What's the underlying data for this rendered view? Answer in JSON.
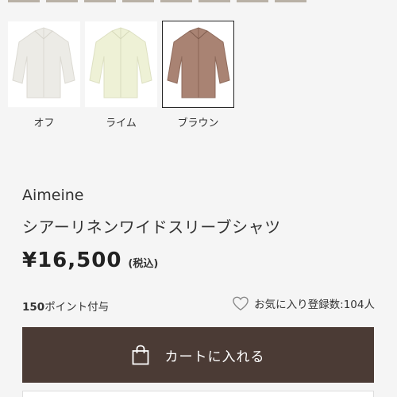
{
  "swatches": [
    {
      "label": "オフ",
      "color": "#f4f3ef",
      "selected": false
    },
    {
      "label": "ライム",
      "color": "#eef1d8",
      "selected": false
    },
    {
      "label": "ブラウン",
      "color": "#a98373",
      "selected": true
    }
  ],
  "product": {
    "brand": "Aimeine",
    "title": "シアーリネンワイドスリーブシャツ",
    "price": "¥16,500",
    "tax_note": "(税込)"
  },
  "points": {
    "value": "150",
    "suffix": "ポイント付与"
  },
  "favorite": {
    "label": "お気に入り登録数:104人",
    "icon": "heart-icon"
  },
  "cart": {
    "label": "カートに入れる",
    "icon": "shopping-bag-icon",
    "bg": "#4b3b35"
  }
}
